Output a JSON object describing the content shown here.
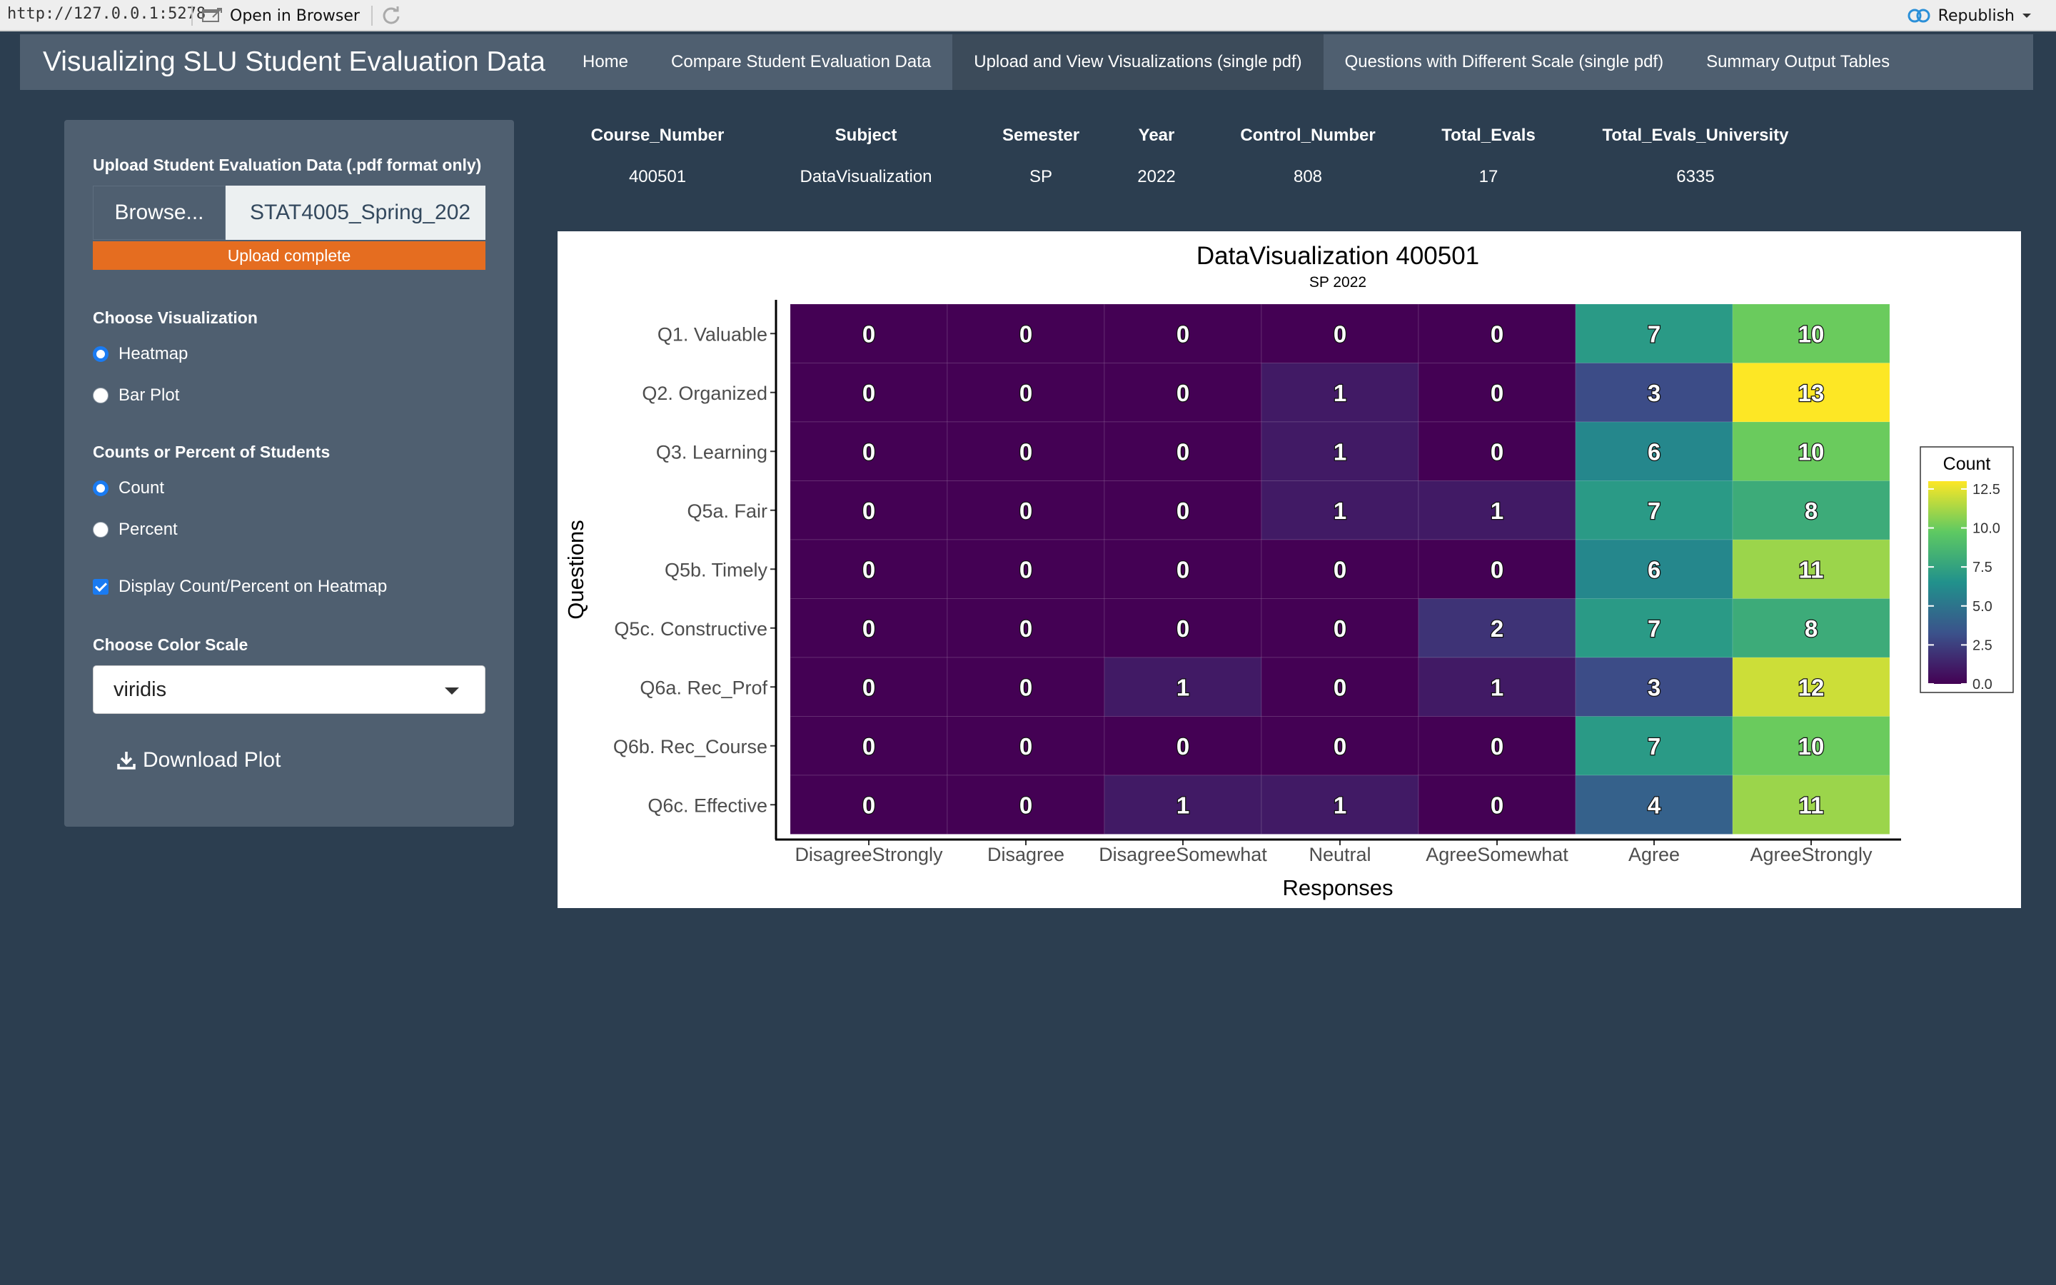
{
  "topbar": {
    "url": "http://127.0.0.1:5278",
    "open_browser": "Open in Browser",
    "republish": "Republish"
  },
  "navbar": {
    "brand": "Visualizing SLU Student Evaluation Data",
    "tabs": [
      {
        "label": "Home"
      },
      {
        "label": "Compare Student Evaluation Data"
      },
      {
        "label": "Upload and View Visualizations (single pdf)"
      },
      {
        "label": "Questions with Different Scale (single pdf)"
      },
      {
        "label": "Summary Output Tables"
      }
    ],
    "active_tab": 2
  },
  "sidebar": {
    "upload_label": "Upload Student Evaluation Data (.pdf format only)",
    "browse_label": "Browse...",
    "file_name": "STAT4005_Spring_202",
    "progress_text": "Upload complete",
    "progress_color": "#e56d20",
    "viz_label": "Choose Visualization",
    "viz_options": [
      "Heatmap",
      "Bar Plot"
    ],
    "viz_selected": "Heatmap",
    "measure_label": "Counts or Percent of Students",
    "measure_options": [
      "Count",
      "Percent"
    ],
    "measure_selected": "Count",
    "display_label": "Display Count/Percent on Heatmap",
    "display_checked": true,
    "color_label": "Choose Color Scale",
    "color_value": "viridis",
    "download_label": "Download Plot"
  },
  "summary": {
    "headers": [
      "Course_Number",
      "Subject",
      "Semester",
      "Year",
      "Control_Number",
      "Total_Evals",
      "Total_Evals_University"
    ],
    "values": [
      "400501",
      "DataVisualization",
      "SP",
      "2022",
      "808",
      "17",
      "6335"
    ]
  },
  "chart_data": {
    "type": "heatmap",
    "title": "DataVisualization 400501",
    "subtitle": "SP 2022",
    "xlabel": "Responses",
    "ylabel": "Questions",
    "x": [
      "DisagreeStrongly",
      "Disagree",
      "DisagreeSomewhat",
      "Neutral",
      "AgreeSomewhat",
      "Agree",
      "AgreeStrongly"
    ],
    "y": [
      "Q1. Valuable",
      "Q2. Organized",
      "Q3. Learning",
      "Q5a. Fair",
      "Q5b. Timely",
      "Q5c. Constructive",
      "Q6a. Rec_Prof",
      "Q6b. Rec_Course",
      "Q6c. Effective"
    ],
    "values": [
      [
        0,
        0,
        0,
        0,
        0,
        7,
        10
      ],
      [
        0,
        0,
        0,
        1,
        0,
        3,
        13
      ],
      [
        0,
        0,
        0,
        1,
        0,
        6,
        10
      ],
      [
        0,
        0,
        0,
        1,
        1,
        7,
        8
      ],
      [
        0,
        0,
        0,
        0,
        0,
        6,
        11
      ],
      [
        0,
        0,
        0,
        0,
        2,
        7,
        8
      ],
      [
        0,
        0,
        1,
        0,
        1,
        3,
        12
      ],
      [
        0,
        0,
        0,
        0,
        0,
        7,
        10
      ],
      [
        0,
        0,
        1,
        1,
        0,
        4,
        11
      ]
    ],
    "legend_title": "Count",
    "legend_ticks": [
      "12.5",
      "10.0",
      "7.5",
      "5.0",
      "2.5",
      "0.0"
    ],
    "legend_position": "right",
    "color_scale": "viridis",
    "vmin": 0,
    "vmax": 13,
    "grid": false
  }
}
